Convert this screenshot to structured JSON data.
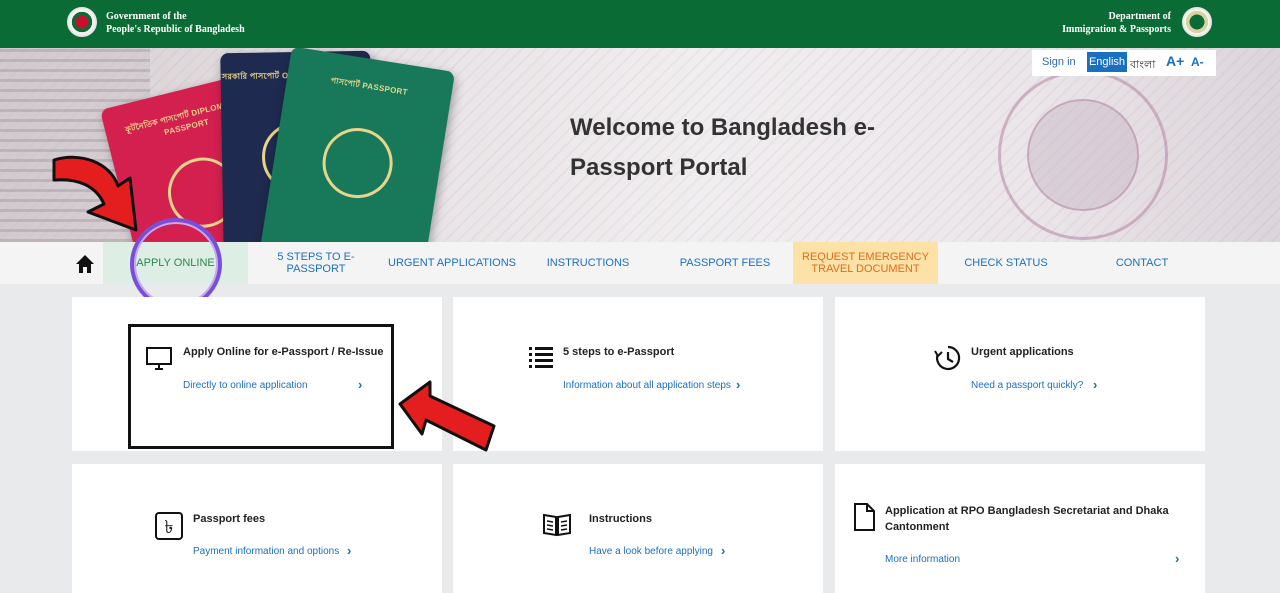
{
  "header": {
    "gov_line1": "Government of the",
    "gov_line2": "People's Republic of Bangladesh",
    "dept_line1": "Department of",
    "dept_line2": "Immigration & Passports"
  },
  "lang": {
    "sign_in": "Sign in",
    "english": "English",
    "bangla": "বাংলা",
    "font_up": "A+",
    "font_down": "A-"
  },
  "hero": {
    "welcome_line1": "Welcome to Bangladesh e-",
    "welcome_line2": "Passport Portal",
    "pp_red_label": "কূটনৈতিক পাসপোর্ট DIPLOMATIC PASSPORT",
    "pp_blue_label": "সরকারি পাসপোর্ট OFFICIAL PASSPORT",
    "pp_green_label": "পাসপোর্ট PASSPORT"
  },
  "nav": {
    "apply": "APPLY ONLINE",
    "steps": "5 STEPS TO e-PASSPORT",
    "urgent": "URGENT APPLICATIONS",
    "instructions": "INSTRUCTIONS",
    "fees": "PASSPORT FEES",
    "emergency": "REQUEST EMERGENCY TRAVEL DOCUMENT",
    "check": "CHECK STATUS",
    "contact": "CONTACT"
  },
  "cards": {
    "apply": {
      "title": "Apply Online for e-Passport / Re-Issue",
      "link": "Directly to online application"
    },
    "steps": {
      "title": "5 steps to e-Passport",
      "link": "Information about all application steps"
    },
    "urgent": {
      "title": "Urgent applications",
      "link": "Need a passport quickly?"
    },
    "fees": {
      "title": "Passport fees",
      "link": "Payment information and options"
    },
    "instructions": {
      "title": "Instructions",
      "link": "Have a look before applying"
    },
    "rpo": {
      "title": "Application at RPO Bangladesh Secretariat and Dhaka Cantonment",
      "link": "More information"
    }
  },
  "icons": {
    "chevron": "›",
    "taka": "৳"
  },
  "colors": {
    "header_green": "#0a6b34",
    "link_blue": "#1a6fc0",
    "emergency_bg": "#fde2a8",
    "apply_bg": "#ddeee4"
  }
}
